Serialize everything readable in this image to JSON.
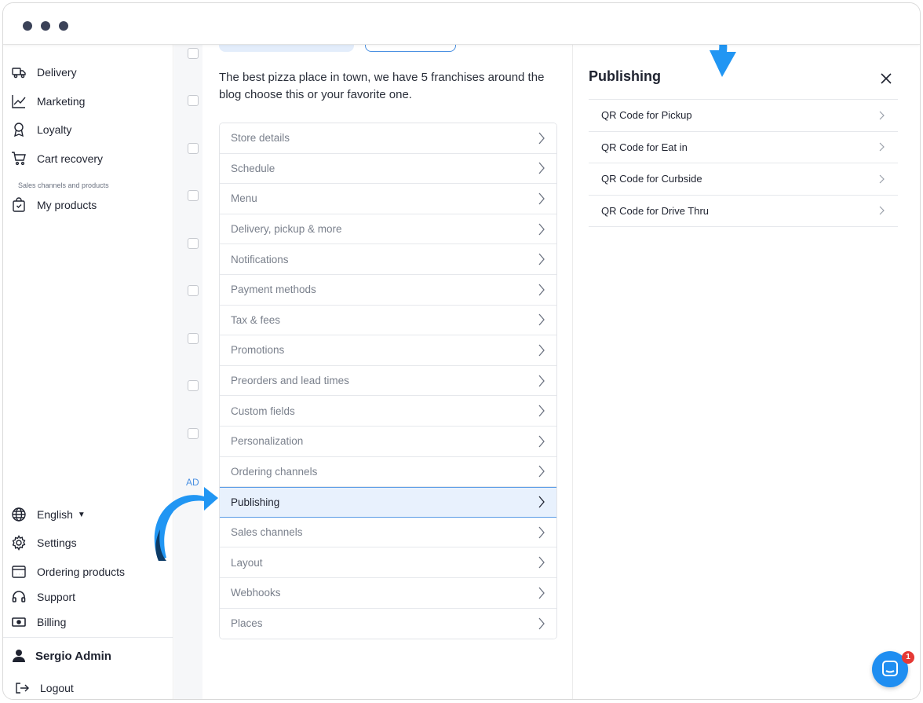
{
  "sidebar": {
    "items_top": [
      {
        "label": "Delivery",
        "icon": "truck-icon"
      },
      {
        "label": "Marketing",
        "icon": "chart-line-icon"
      },
      {
        "label": "Loyalty",
        "icon": "award-icon"
      },
      {
        "label": "Cart recovery",
        "icon": "cart-icon"
      }
    ],
    "section_label": "Sales channels and products",
    "my_products": "My products",
    "language": "English",
    "settings": "Settings",
    "ordering_products": "Ordering products",
    "support": "Support",
    "billing": "Billing",
    "user_name": "Sergio Admin",
    "logout": "Logout"
  },
  "middle": {
    "partial_text": "AD"
  },
  "panel": {
    "description": "The best pizza place in town, we have 5 franchises around the blog choose this or your favorite one.",
    "menu": [
      "Store details",
      "Schedule",
      "Menu",
      "Delivery, pickup & more",
      "Notifications",
      "Payment methods",
      "Tax & fees",
      "Promotions",
      "Preorders and lead times",
      "Custom fields",
      "Personalization",
      "Ordering channels",
      "Publishing",
      "Sales channels",
      "Layout",
      "Webhooks",
      "Places"
    ],
    "active_item": "Publishing"
  },
  "publishing": {
    "title": "Publishing",
    "items": [
      "QR Code for Pickup",
      "QR Code for Eat in",
      "QR Code for Curbside",
      "QR Code for Drive Thru"
    ]
  },
  "chat": {
    "badge_count": "1"
  },
  "colors": {
    "accent": "#1f8ef1",
    "active_bg": "#e8f1fd",
    "active_border": "#5a9be6",
    "arrow_light": "#2196f3",
    "arrow_dark": "#0d3b66"
  }
}
